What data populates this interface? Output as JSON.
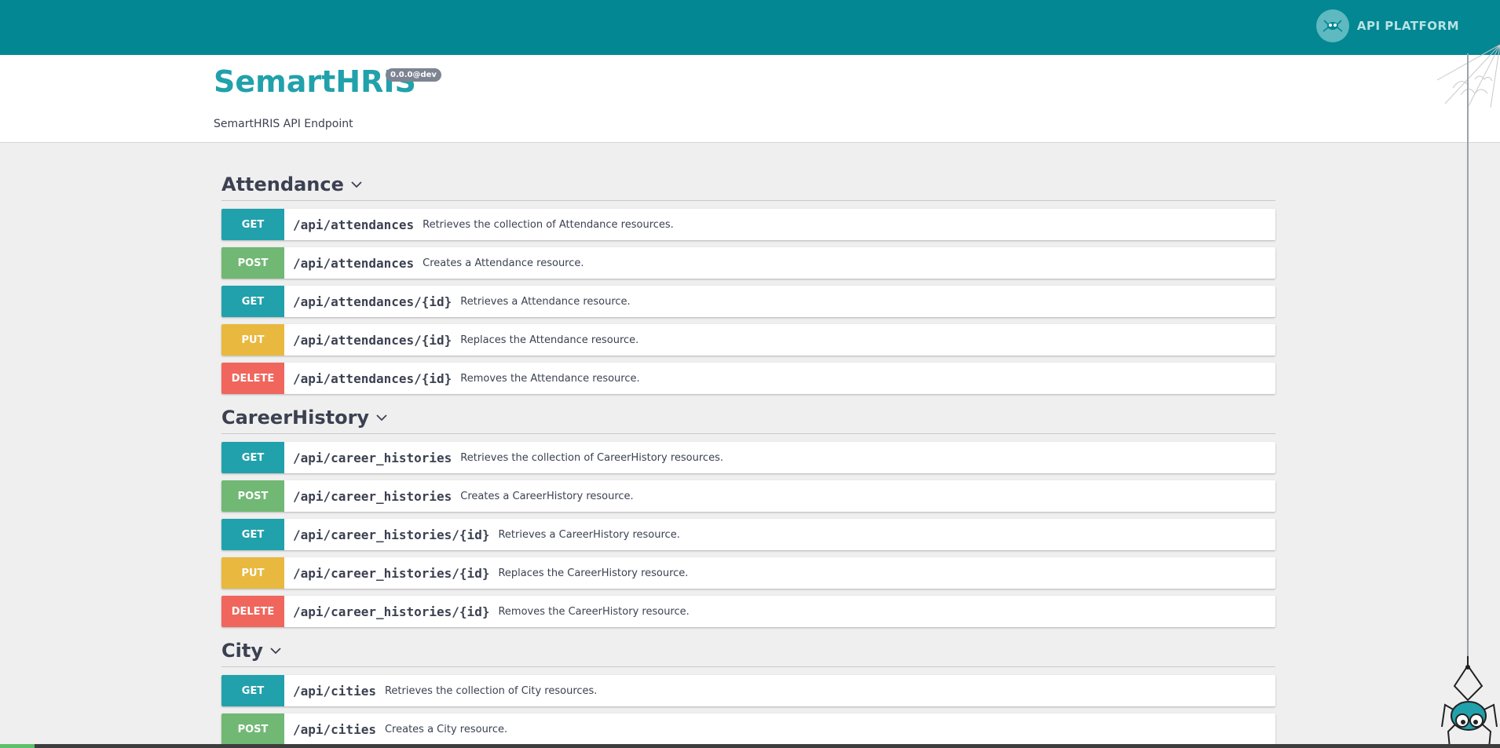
{
  "topbar": {
    "brand_text": "API PLATFORM",
    "color": "#038792"
  },
  "info": {
    "title": "SemartHRIS",
    "version": "0.0.0@dev",
    "description": "SemartHRIS API Endpoint"
  },
  "colors": {
    "get": "#21a1ab",
    "post": "#71b874",
    "put": "#e9b83f",
    "delete": "#f0665d"
  },
  "sections": [
    {
      "name": "Attendance",
      "operations": [
        {
          "method": "GET",
          "path": "/api/attendances",
          "summary": "Retrieves the collection of Attendance resources."
        },
        {
          "method": "POST",
          "path": "/api/attendances",
          "summary": "Creates a Attendance resource."
        },
        {
          "method": "GET",
          "path": "/api/attendances/{id}",
          "summary": "Retrieves a Attendance resource."
        },
        {
          "method": "PUT",
          "path": "/api/attendances/{id}",
          "summary": "Replaces the Attendance resource."
        },
        {
          "method": "DELETE",
          "path": "/api/attendances/{id}",
          "summary": "Removes the Attendance resource."
        }
      ]
    },
    {
      "name": "CareerHistory",
      "operations": [
        {
          "method": "GET",
          "path": "/api/career_histories",
          "summary": "Retrieves the collection of CareerHistory resources."
        },
        {
          "method": "POST",
          "path": "/api/career_histories",
          "summary": "Creates a CareerHistory resource."
        },
        {
          "method": "GET",
          "path": "/api/career_histories/{id}",
          "summary": "Retrieves a CareerHistory resource."
        },
        {
          "method": "PUT",
          "path": "/api/career_histories/{id}",
          "summary": "Replaces the CareerHistory resource."
        },
        {
          "method": "DELETE",
          "path": "/api/career_histories/{id}",
          "summary": "Removes the CareerHistory resource."
        }
      ]
    },
    {
      "name": "City",
      "operations": [
        {
          "method": "GET",
          "path": "/api/cities",
          "summary": "Retrieves the collection of City resources."
        },
        {
          "method": "POST",
          "path": "/api/cities",
          "summary": "Creates a City resource."
        }
      ]
    }
  ]
}
